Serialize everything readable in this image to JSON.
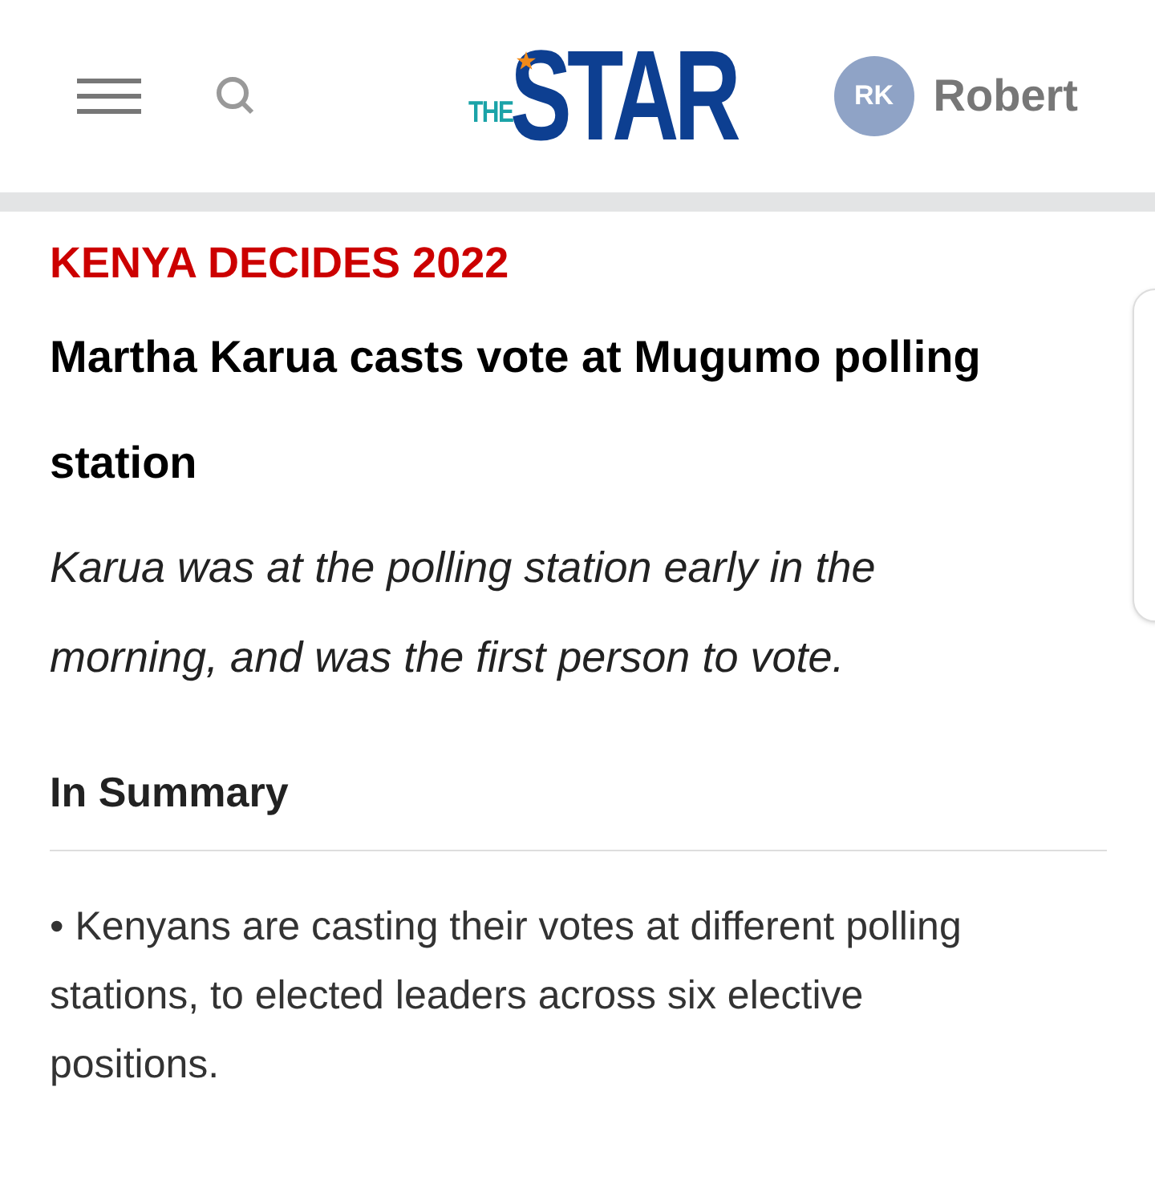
{
  "header": {
    "logo": {
      "small": "THE",
      "large": "STAR"
    },
    "avatar_initials": "RK",
    "user_name": "Robert"
  },
  "article": {
    "section": "KENYA DECIDES 2022",
    "headline": "Martha Karua casts vote at Mugumo polling station",
    "standfirst": "Karua was at the polling station early in the morning, and was the first person to vote.",
    "summary_title": "In Summary",
    "summary_points": [
      "• Kenyans are casting their votes at different polling stations, to elected leaders across six elective positions."
    ]
  }
}
